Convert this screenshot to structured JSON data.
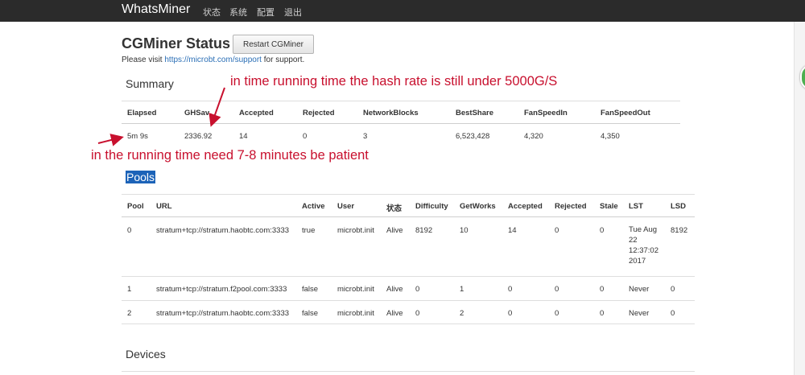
{
  "navbar": {
    "brand": "WhatsMiner",
    "items": [
      "状态",
      "系统",
      "配置",
      "退出"
    ]
  },
  "page": {
    "title": "CGMiner Status",
    "restart_label": "Restart CGMiner",
    "support_prefix": "Please visit",
    "support_link": "https://microbt.com/support",
    "support_suffix": "for support."
  },
  "summary": {
    "title": "Summary",
    "headers": [
      "Elapsed",
      "GHSav",
      "Accepted",
      "Rejected",
      "NetworkBlocks",
      "BestShare",
      "FanSpeedIn",
      "FanSpeedOut"
    ],
    "row": [
      "5m 9s",
      "2336.92",
      "14",
      "0",
      "3",
      "6,523,428",
      "4,320",
      "4,350"
    ]
  },
  "pools": {
    "title": "Pools",
    "headers": [
      "Pool",
      "URL",
      "Active",
      "User",
      "状态",
      "Difficulty",
      "GetWorks",
      "Accepted",
      "Rejected",
      "Stale",
      "LST",
      "LSD"
    ],
    "rows": [
      [
        "0",
        "stratum+tcp://stratum.haobtc.com:3333",
        "true",
        "microbt.init",
        "Alive",
        "8192",
        "10",
        "14",
        "0",
        "0",
        "Tue Aug 22 12:37:02 2017",
        "8192"
      ],
      [
        "1",
        "stratum+tcp://stratum.f2pool.com:3333",
        "false",
        "microbt.init",
        "Alive",
        "0",
        "1",
        "0",
        "0",
        "0",
        "Never",
        "0"
      ],
      [
        "2",
        "stratum+tcp://stratum.haobtc.com:3333",
        "false",
        "microbt.init",
        "Alive",
        "0",
        "2",
        "0",
        "0",
        "0",
        "Never",
        "0"
      ]
    ]
  },
  "devices": {
    "title": "Devices"
  },
  "annotations": {
    "hashrate_note": "in time running time the hash rate is still under 5000G/S",
    "patience_note": "in the running time need 7-8 minutes be patient",
    "color": "#c8102e"
  },
  "colors": {
    "navbar": "#2b2b2b",
    "link": "#2b6fb6",
    "selection": "#1c63b8"
  }
}
